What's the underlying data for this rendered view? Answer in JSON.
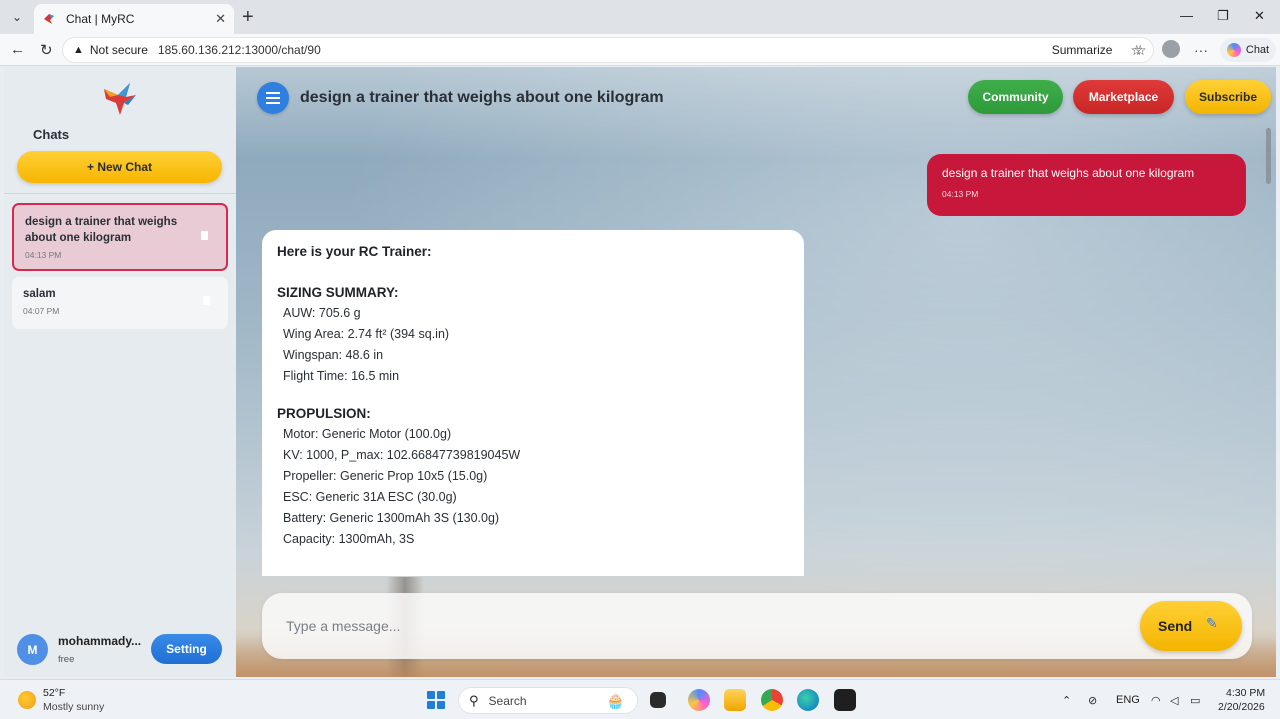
{
  "browser": {
    "tab_title": "Chat | MyRC",
    "security_label": "Not secure",
    "url": "185.60.136.212:13000/chat/90",
    "summarize_label": "Summarize",
    "copilot_label": "Chat"
  },
  "sidebar": {
    "chats_heading": "Chats",
    "new_chat_label": "+ New Chat",
    "items": [
      {
        "title": "design a trainer that weighs about one kilogram",
        "time": "04:13 PM",
        "active": true
      },
      {
        "title": "salam",
        "time": "04:07 PM",
        "active": false
      }
    ],
    "user": {
      "initial": "M",
      "name": "mohammady...",
      "plan": "free"
    },
    "setting_label": "Setting"
  },
  "header": {
    "title": "design a trainer that weighs about one kilogram",
    "community_label": "Community",
    "marketplace_label": "Marketplace",
    "subscribe_label": "Subscribe"
  },
  "messages": {
    "user": {
      "text": "design a trainer that weighs about one kilogram",
      "time": "04:13 PM"
    },
    "bot": {
      "heading": "Here is your RC Trainer:",
      "sections": [
        {
          "title": "SIZING SUMMARY:",
          "lines": [
            "AUW: 705.6 g",
            "Wing Area: 2.74 ft² (394 sq.in)",
            "Wingspan: 48.6 in",
            "Flight Time: 16.5 min"
          ]
        },
        {
          "title": "PROPULSION:",
          "lines": [
            "Motor: Generic Motor (100.0g)",
            "KV: 1000, P_max: 102.66847739819045W",
            "Propeller: Generic Prop 10x5 (15.0g)",
            "ESC: Generic 31A ESC (30.0g)",
            "Battery: Generic 1300mAh 3S (130.0g)",
            "Capacity: 1300mAh, 3S"
          ]
        }
      ]
    }
  },
  "composer": {
    "placeholder": "Type a message...",
    "send_label": "Send"
  },
  "taskbar": {
    "weather_temp": "52°F",
    "weather_desc": "Mostly sunny",
    "search_label": "Search",
    "lang": "ENG",
    "time": "4:30 PM",
    "date": "2/20/2026"
  },
  "colors": {
    "accent_red": "#c7173a",
    "accent_yellow": "#f4b400",
    "accent_blue": "#2f7fe0",
    "accent_green": "#2e9a3a"
  }
}
